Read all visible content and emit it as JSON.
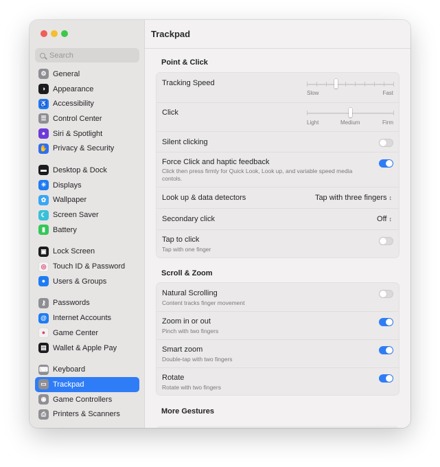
{
  "window": {
    "title": "Trackpad"
  },
  "search": {
    "placeholder": "Search"
  },
  "colors": {
    "accent": "#2f7df6",
    "close": "#ee5f58",
    "minimize": "#f6bd2f",
    "zoom": "#3ec847"
  },
  "sidebar": {
    "groups": [
      [
        {
          "label": "General",
          "icon": "gear-icon",
          "color": "#8e8e93"
        },
        {
          "label": "Appearance",
          "icon": "appearance-icon",
          "color": "#1c1c1e"
        },
        {
          "label": "Accessibility",
          "icon": "accessibility-icon",
          "color": "#1e7cf2"
        },
        {
          "label": "Control Center",
          "icon": "control-center-icon",
          "color": "#8e8e93"
        },
        {
          "label": "Siri & Spotlight",
          "icon": "siri-icon",
          "color": "#6e3ad8"
        },
        {
          "label": "Privacy & Security",
          "icon": "hand-icon",
          "color": "#2f6ff0"
        }
      ],
      [
        {
          "label": "Desktop & Dock",
          "icon": "dock-icon",
          "color": "#1c1c1e"
        },
        {
          "label": "Displays",
          "icon": "sun-icon",
          "color": "#1e7cf2"
        },
        {
          "label": "Wallpaper",
          "icon": "wallpaper-icon",
          "color": "#3aa6f4"
        },
        {
          "label": "Screen Saver",
          "icon": "screen-saver-icon",
          "color": "#3ac0d8"
        },
        {
          "label": "Battery",
          "icon": "battery-icon",
          "color": "#34c759"
        }
      ],
      [
        {
          "label": "Lock Screen",
          "icon": "lock-screen-icon",
          "color": "#1c1c1e"
        },
        {
          "label": "Touch ID & Password",
          "icon": "fingerprint-icon",
          "color": "#f2f2f2"
        },
        {
          "label": "Users & Groups",
          "icon": "users-icon",
          "color": "#1e7cf2"
        }
      ],
      [
        {
          "label": "Passwords",
          "icon": "key-icon",
          "color": "#8e8e93"
        },
        {
          "label": "Internet Accounts",
          "icon": "at-icon",
          "color": "#1e7cf2"
        },
        {
          "label": "Game Center",
          "icon": "game-center-icon",
          "color": "#f2f2f2"
        },
        {
          "label": "Wallet & Apple Pay",
          "icon": "wallet-icon",
          "color": "#1c1c1e"
        }
      ],
      [
        {
          "label": "Keyboard",
          "icon": "keyboard-icon",
          "color": "#8e8e93"
        },
        {
          "label": "Trackpad",
          "icon": "trackpad-icon",
          "color": "#8e8e93",
          "selected": true
        },
        {
          "label": "Game Controllers",
          "icon": "gamepad-icon",
          "color": "#8e8e93"
        },
        {
          "label": "Printers & Scanners",
          "icon": "printer-icon",
          "color": "#8e8e93"
        }
      ]
    ]
  },
  "point_click": {
    "title": "Point & Click",
    "tracking_speed": {
      "label": "Tracking Speed",
      "min_label": "Slow",
      "max_label": "Fast",
      "value": 0.33
    },
    "click": {
      "label": "Click",
      "min_label": "Light",
      "mid_label": "Medium",
      "max_label": "Firm",
      "value": 0.5
    },
    "silent_clicking": {
      "label": "Silent clicking",
      "on": false
    },
    "force_click": {
      "label": "Force Click and haptic feedback",
      "subtitle": "Click then press firmly for Quick Look, Look up, and variable speed media contols.",
      "on": true
    },
    "look_up": {
      "label": "Look up & data detectors",
      "value": "Tap with three fingers"
    },
    "secondary_click": {
      "label": "Secondary click",
      "value": "Off"
    },
    "tap_to_click": {
      "label": "Tap to click",
      "subtitle": "Tap with one finger",
      "on": false
    }
  },
  "scroll_zoom": {
    "title": "Scroll & Zoom",
    "natural_scrolling": {
      "label": "Natural Scrolling",
      "subtitle": "Content tracks finger movement",
      "on": false
    },
    "zoom_in_out": {
      "label": "Zoom in or out",
      "subtitle": "Pinch with two fingers",
      "on": true
    },
    "smart_zoom": {
      "label": "Smart zoom",
      "subtitle": "Double-tap with two fingers",
      "on": true
    },
    "rotate": {
      "label": "Rotate",
      "subtitle": "Rotate with two fingers",
      "on": true
    }
  },
  "more_gestures": {
    "title": "More Gestures"
  }
}
